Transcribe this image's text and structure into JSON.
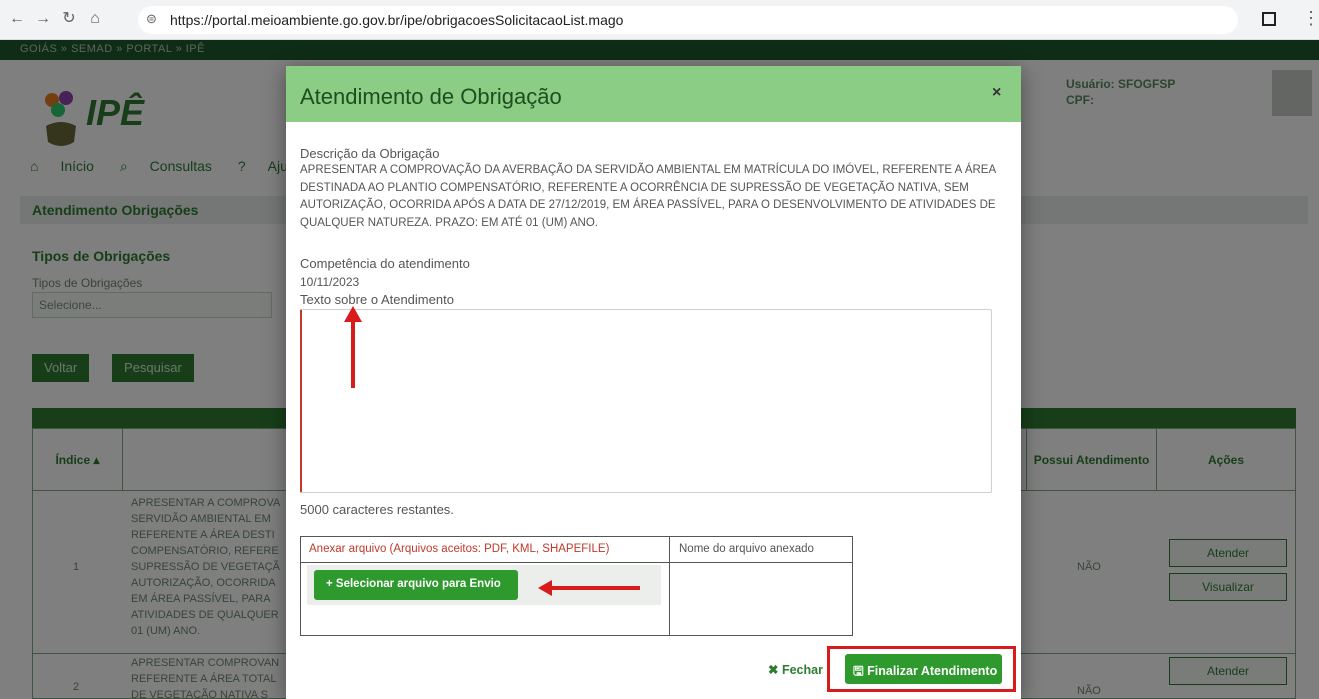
{
  "browser": {
    "url": "https://portal.meioambiente.go.gov.br/ipe/obrigacoesSolicitacaoList.mago"
  },
  "page": {
    "breadcrumb": "GOIÁS » SEMAD » PORTAL » IPÊ",
    "logo_text": "IPÊ",
    "user_label": "Usuário: SFOGFSP",
    "cpf_label": "CPF:",
    "nav": [
      "Início",
      "Consultas",
      "Ajuda"
    ],
    "section_title": "Atendimento Obrigações",
    "tipos_title": "Tipos de Obrigações",
    "tipos_label": "Tipos de Obrigações",
    "tipos_placeholder": "Selecione...",
    "voltar": "Voltar",
    "pesquisar": "Pesquisar",
    "table": {
      "col_indice": "Índice",
      "col_possui": "Possui Atendimento",
      "col_acoes": "Ações",
      "rows": [
        {
          "index": "1",
          "text": "APRESENTAR A COMPROVA SERVIDÃO AMBIENTAL EM REFERENTE A ÁREA DESTI COMPENSATÓRIO, REFERE SUPRESSÃO DE VEGETAÇÃ AUTORIZAÇÃO, OCORRIDA EM ÁREA PASSÍVEL, PARA ATIVIDADES DE QUALQUER 01 (UM) ANO.",
          "possui": "NÃO",
          "btn1": "Atender",
          "btn2": "Visualizar"
        },
        {
          "index": "2",
          "text": "APRESENTAR COMPROVAN REFERENTE A ÁREA TOTAL DE VEGETAÇÃO NATIVA S",
          "possui": "NÃO",
          "btn1": "Atender"
        }
      ]
    }
  },
  "modal": {
    "title": "Atendimento de Obrigação",
    "close": "×",
    "desc_label": "Descrição da Obrigação",
    "desc_text": "APRESENTAR A COMPROVAÇÃO DA AVERBAÇÃO DA SERVIDÃO AMBIENTAL EM MATRÍCULA DO IMÓVEL, REFERENTE A ÁREA DESTINADA AO PLANTIO COMPENSATÓRIO, REFERENTE A OCORRÊNCIA DE SUPRESSÃO DE VEGETAÇÃO NATIVA, SEM AUTORIZAÇÃO, OCORRIDA APÓS A DATA DE 27/12/2019, EM ÁREA PASSÍVEL, PARA O DESENVOLVIMENTO DE ATIVIDADES DE QUALQUER NATUREZA. PRAZO: EM ATÉ 01 (UM) ANO.",
    "competencia_label": "Competência do atendimento",
    "competencia_value": "10/11/2023",
    "texto_label": "Texto sobre o Atendimento",
    "chars_left": "5000 caracteres restantes.",
    "attach_header": "Anexar arquivo (Arquivos aceitos: PDF, KML, SHAPEFILE)",
    "attached_name_header": "Nome do arquivo anexado",
    "select_file_button": "Selecionar arquivo para Envio",
    "fechar": "Fechar",
    "finalizar": "Finalizar Atendimento"
  },
  "colors": {
    "modal_header": "#8ccd85",
    "primary_button": "#2e9a2e",
    "highlight": "#d81b1b"
  }
}
